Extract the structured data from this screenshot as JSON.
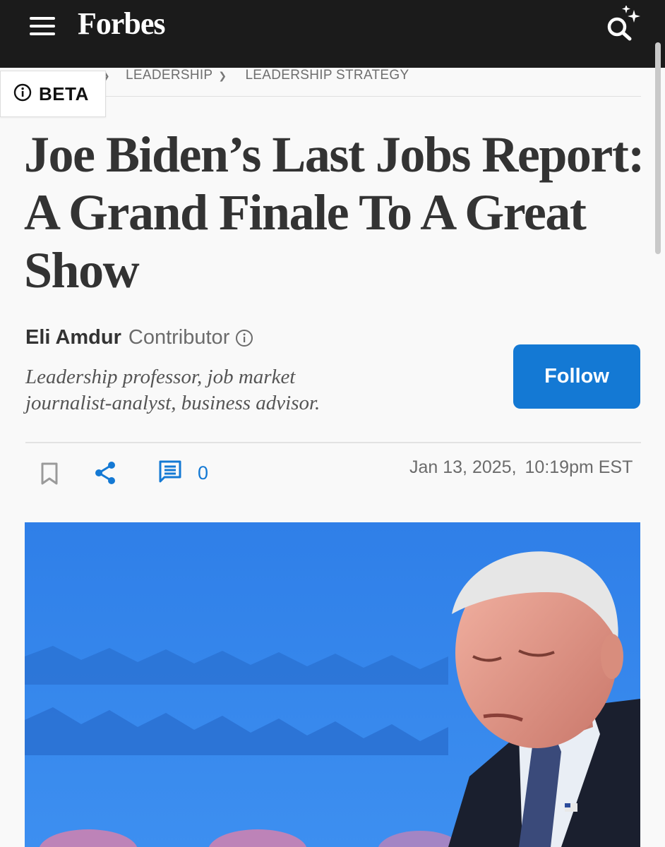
{
  "header": {
    "brand": "Forbes",
    "menu_icon": "hamburger-menu-icon",
    "search_icon": "sparkle-search-icon",
    "background": "#1b1b1b"
  },
  "beta_badge": {
    "label": "BETA",
    "icon": "info-circle-icon"
  },
  "breadcrumb": {
    "items": [
      "LEADERSHIP",
      "LEADERSHIP STRATEGY"
    ]
  },
  "article": {
    "headline_lines": [
      "Joe Biden’s Last Jobs Report:",
      "A Grand Finale To A Great",
      "Show"
    ],
    "author": {
      "name": "Eli Amdur",
      "role": "Contributor",
      "bio_lines": [
        "Leadership professor, job market",
        "journalist-analyst, business advisor."
      ]
    },
    "follow_label": "Follow",
    "comment_count": "0",
    "date": "Jan 13, 2025,",
    "time": "10:19pm EST"
  },
  "hero_image": {
    "alt": "Man with gray hair in dark suit and blue tie, eyes closed, in front of a blue backdrop"
  },
  "colors": {
    "accent": "#1479d4",
    "hero_background": "#2f84e6",
    "text": "#333333"
  }
}
